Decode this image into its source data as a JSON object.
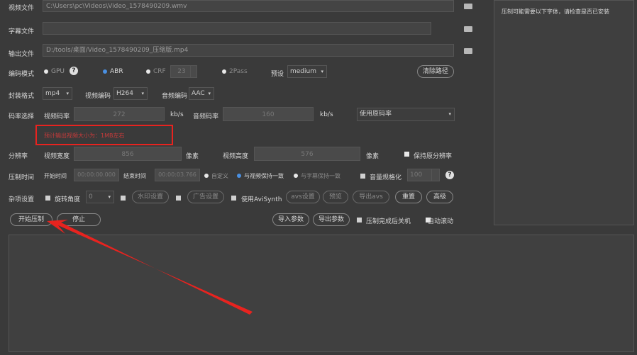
{
  "files": {
    "video_label": "视频文件",
    "video_path": "C:\\Users\\pc\\Videos\\Video_1578490209.wmv",
    "subtitle_label": "字幕文件",
    "subtitle_path": "",
    "output_label": "输出文件",
    "output_path": "D:/tools/桌面/Video_1578490209_压缩版.mp4"
  },
  "right_panel": {
    "notice": "压制可能需要以下字体，请检查是否已安装"
  },
  "encode": {
    "label": "编码模式",
    "gpu": "GPU",
    "abr": "ABR",
    "crf": "CRF",
    "crf_value": "23",
    "twopass": "2Pass",
    "preset_label": "预设",
    "preset_value": "medium",
    "clear_path": "清除路径"
  },
  "container": {
    "label": "封装格式",
    "format": "mp4",
    "video_codec_label": "视频编码",
    "video_codec": "H264",
    "audio_codec_label": "音频编码",
    "audio_codec": "AAC"
  },
  "bitrate": {
    "label": "码率选择",
    "video_label": "视频码率",
    "video_value": "272",
    "video_unit": "kb/s",
    "audio_label": "音频码率",
    "audio_value": "160",
    "audio_unit": "kb/s",
    "mode": "使用原码率",
    "warning": "预计输出视频大小为：1MB左右"
  },
  "resolution": {
    "label": "分辨率",
    "width_label": "视频宽度",
    "width": "856",
    "width_unit": "像素",
    "height_label": "视频高度",
    "height": "576",
    "height_unit": "像素",
    "keep": "保持原分辨率"
  },
  "timing": {
    "label": "压制时间",
    "start_label": "开始时间",
    "start": "00:00:00.000",
    "end_label": "结束时间",
    "end": "00:00:03.766",
    "custom": "自定义",
    "keep_video": "与视频保持一致",
    "keep_subtitle": "与字幕保持一致",
    "normalize": "音量规格化",
    "normalize_value": "100"
  },
  "misc": {
    "label": "杂项设置",
    "rotate_label": "旋转角度",
    "rotate_value": "0",
    "watermark": "水印设置",
    "ad": "广告设置",
    "avisynth": "使用AviSynth",
    "avs_settings": "avs设置",
    "preview": "预览",
    "export_avs": "导出avs",
    "reset": "重置",
    "advanced": "高级"
  },
  "actions": {
    "start": "开始压制",
    "stop": "停止",
    "import": "导入参数",
    "export": "导出参数",
    "shutdown": "压制完成后关机",
    "autoscroll": "自动滚动"
  },
  "colors": {
    "annotation": "#e8231f",
    "accent": "#4a90e2",
    "background": "#3a3a3a"
  },
  "icons": [
    "folder-icon",
    "help-icon",
    "chevron-down-icon"
  ]
}
